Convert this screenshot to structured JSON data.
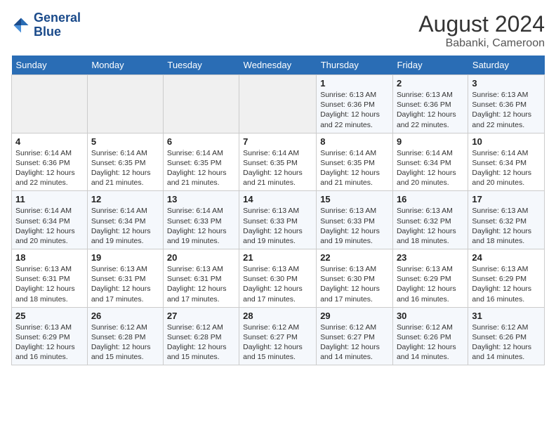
{
  "logo": {
    "line1": "General",
    "line2": "Blue"
  },
  "title": "August 2024",
  "location": "Babanki, Cameroon",
  "days_of_week": [
    "Sunday",
    "Monday",
    "Tuesday",
    "Wednesday",
    "Thursday",
    "Friday",
    "Saturday"
  ],
  "weeks": [
    [
      {
        "day": "",
        "info": ""
      },
      {
        "day": "",
        "info": ""
      },
      {
        "day": "",
        "info": ""
      },
      {
        "day": "",
        "info": ""
      },
      {
        "day": "1",
        "info": "Sunrise: 6:13 AM\nSunset: 6:36 PM\nDaylight: 12 hours\nand 22 minutes."
      },
      {
        "day": "2",
        "info": "Sunrise: 6:13 AM\nSunset: 6:36 PM\nDaylight: 12 hours\nand 22 minutes."
      },
      {
        "day": "3",
        "info": "Sunrise: 6:13 AM\nSunset: 6:36 PM\nDaylight: 12 hours\nand 22 minutes."
      }
    ],
    [
      {
        "day": "4",
        "info": "Sunrise: 6:14 AM\nSunset: 6:36 PM\nDaylight: 12 hours\nand 22 minutes."
      },
      {
        "day": "5",
        "info": "Sunrise: 6:14 AM\nSunset: 6:35 PM\nDaylight: 12 hours\nand 21 minutes."
      },
      {
        "day": "6",
        "info": "Sunrise: 6:14 AM\nSunset: 6:35 PM\nDaylight: 12 hours\nand 21 minutes."
      },
      {
        "day": "7",
        "info": "Sunrise: 6:14 AM\nSunset: 6:35 PM\nDaylight: 12 hours\nand 21 minutes."
      },
      {
        "day": "8",
        "info": "Sunrise: 6:14 AM\nSunset: 6:35 PM\nDaylight: 12 hours\nand 21 minutes."
      },
      {
        "day": "9",
        "info": "Sunrise: 6:14 AM\nSunset: 6:34 PM\nDaylight: 12 hours\nand 20 minutes."
      },
      {
        "day": "10",
        "info": "Sunrise: 6:14 AM\nSunset: 6:34 PM\nDaylight: 12 hours\nand 20 minutes."
      }
    ],
    [
      {
        "day": "11",
        "info": "Sunrise: 6:14 AM\nSunset: 6:34 PM\nDaylight: 12 hours\nand 20 minutes."
      },
      {
        "day": "12",
        "info": "Sunrise: 6:14 AM\nSunset: 6:34 PM\nDaylight: 12 hours\nand 19 minutes."
      },
      {
        "day": "13",
        "info": "Sunrise: 6:14 AM\nSunset: 6:33 PM\nDaylight: 12 hours\nand 19 minutes."
      },
      {
        "day": "14",
        "info": "Sunrise: 6:13 AM\nSunset: 6:33 PM\nDaylight: 12 hours\nand 19 minutes."
      },
      {
        "day": "15",
        "info": "Sunrise: 6:13 AM\nSunset: 6:33 PM\nDaylight: 12 hours\nand 19 minutes."
      },
      {
        "day": "16",
        "info": "Sunrise: 6:13 AM\nSunset: 6:32 PM\nDaylight: 12 hours\nand 18 minutes."
      },
      {
        "day": "17",
        "info": "Sunrise: 6:13 AM\nSunset: 6:32 PM\nDaylight: 12 hours\nand 18 minutes."
      }
    ],
    [
      {
        "day": "18",
        "info": "Sunrise: 6:13 AM\nSunset: 6:31 PM\nDaylight: 12 hours\nand 18 minutes."
      },
      {
        "day": "19",
        "info": "Sunrise: 6:13 AM\nSunset: 6:31 PM\nDaylight: 12 hours\nand 17 minutes."
      },
      {
        "day": "20",
        "info": "Sunrise: 6:13 AM\nSunset: 6:31 PM\nDaylight: 12 hours\nand 17 minutes."
      },
      {
        "day": "21",
        "info": "Sunrise: 6:13 AM\nSunset: 6:30 PM\nDaylight: 12 hours\nand 17 minutes."
      },
      {
        "day": "22",
        "info": "Sunrise: 6:13 AM\nSunset: 6:30 PM\nDaylight: 12 hours\nand 17 minutes."
      },
      {
        "day": "23",
        "info": "Sunrise: 6:13 AM\nSunset: 6:29 PM\nDaylight: 12 hours\nand 16 minutes."
      },
      {
        "day": "24",
        "info": "Sunrise: 6:13 AM\nSunset: 6:29 PM\nDaylight: 12 hours\nand 16 minutes."
      }
    ],
    [
      {
        "day": "25",
        "info": "Sunrise: 6:13 AM\nSunset: 6:29 PM\nDaylight: 12 hours\nand 16 minutes."
      },
      {
        "day": "26",
        "info": "Sunrise: 6:12 AM\nSunset: 6:28 PM\nDaylight: 12 hours\nand 15 minutes."
      },
      {
        "day": "27",
        "info": "Sunrise: 6:12 AM\nSunset: 6:28 PM\nDaylight: 12 hours\nand 15 minutes."
      },
      {
        "day": "28",
        "info": "Sunrise: 6:12 AM\nSunset: 6:27 PM\nDaylight: 12 hours\nand 15 minutes."
      },
      {
        "day": "29",
        "info": "Sunrise: 6:12 AM\nSunset: 6:27 PM\nDaylight: 12 hours\nand 14 minutes."
      },
      {
        "day": "30",
        "info": "Sunrise: 6:12 AM\nSunset: 6:26 PM\nDaylight: 12 hours\nand 14 minutes."
      },
      {
        "day": "31",
        "info": "Sunrise: 6:12 AM\nSunset: 6:26 PM\nDaylight: 12 hours\nand 14 minutes."
      }
    ]
  ]
}
